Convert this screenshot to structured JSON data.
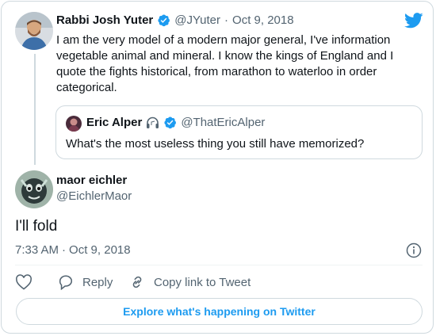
{
  "quoted_tweet": {
    "author_name": "Rabbi Josh Yuter",
    "author_handle": "@JYuter",
    "separator": "·",
    "date": "Oct 9, 2018",
    "text": "I am the very model of a modern major general, I've information vegetable animal and mineral. I know the kings of England and I quote the fights historical, from marathon to waterloo in order categorical.",
    "verified": true
  },
  "inner_quote": {
    "author_name": "Eric Alper",
    "author_handle": "@ThatEricAlper",
    "text": "What's the most useless thing you still have memorized?",
    "verified": true,
    "extra_icon": "headphones-icon"
  },
  "main_tweet": {
    "author_name": "maor eichler",
    "author_handle": "@EichlerMaor",
    "text": "I'll fold",
    "time": "7:33 AM",
    "separator": "·",
    "date": "Oct 9, 2018"
  },
  "actions": {
    "reply_label": "Reply",
    "copy_label": "Copy link to Tweet"
  },
  "explore_label": "Explore what's happening on Twitter",
  "colors": {
    "twitter_blue": "#1d9bf0",
    "border": "#cfd9de",
    "text_primary": "#0f1419",
    "text_secondary": "#536471"
  },
  "icons": [
    "twitter-logo-icon",
    "verified-badge-icon",
    "headphones-icon",
    "info-icon",
    "heart-icon",
    "reply-icon",
    "link-icon"
  ]
}
